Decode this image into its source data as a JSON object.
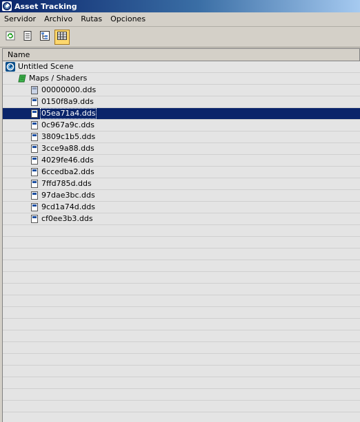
{
  "window": {
    "title": "Asset Tracking"
  },
  "menu": [
    "Servidor",
    "Archivo",
    "Rutas",
    "Opciones"
  ],
  "toolbar": {
    "buttons": [
      {
        "name": "refresh-icon",
        "active": false
      },
      {
        "name": "list-view-icon",
        "active": false
      },
      {
        "name": "tree-view-icon",
        "active": false
      },
      {
        "name": "table-view-icon",
        "active": true
      }
    ]
  },
  "tree": {
    "column_header": "Name",
    "scene": "Untitled Scene",
    "folder": "Maps / Shaders",
    "files": [
      "00000000.dds",
      "0150f8a9.dds",
      "05ea71a4.dds",
      "0c967a9c.dds",
      "3809c1b5.dds",
      "3cce9a88.dds",
      "4029fe46.dds",
      "6ccedba2.dds",
      "7ffd785d.dds",
      "97dae3bc.dds",
      "9cd1a74d.dds",
      "cf0ee3b3.dds"
    ],
    "selected_index": 2
  },
  "colors": {
    "selection": "#0a246a",
    "titlebar": "#0a246a",
    "active_button": "#fdd86e"
  }
}
